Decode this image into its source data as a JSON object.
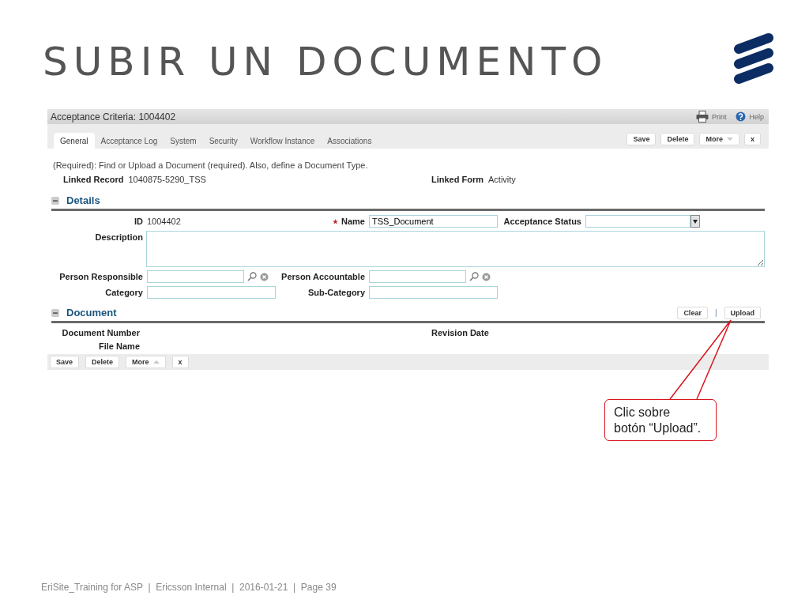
{
  "slide_title": "SUBIR UN DOCUMENTO",
  "app": {
    "title": "Acceptance Criteria: 1004402",
    "header_links": [
      {
        "kind": "print",
        "label": "Print"
      },
      {
        "kind": "help",
        "label": "Help"
      }
    ],
    "tabs": [
      {
        "label": "General",
        "selected": true
      },
      {
        "label": "Acceptance Log",
        "selected": false
      },
      {
        "label": "System",
        "selected": false
      },
      {
        "label": "Security",
        "selected": false
      },
      {
        "label": "Workflow Instance",
        "selected": false
      },
      {
        "label": "Associations",
        "selected": false
      }
    ],
    "top_buttons": [
      {
        "kind": "plain",
        "label": "Save"
      },
      {
        "kind": "plain",
        "label": "Delete"
      },
      {
        "kind": "menu_down",
        "label": "More"
      },
      {
        "kind": "plain",
        "label": "x"
      }
    ],
    "instructions": "(Required): Find or Upload a Document (required). Also, define a Document Type.",
    "linked": [
      {
        "label": "Linked Record",
        "value": "1040875-5290_TSS"
      },
      {
        "label": "Linked Form",
        "value": "Activity"
      }
    ],
    "details": {
      "title": "Details",
      "expanded": true,
      "rows": [
        [
          {
            "kind": "readout",
            "label": "ID",
            "value": "1004402",
            "required": false
          },
          {
            "kind": "input",
            "label": "Name",
            "value": "TSS_Document",
            "required": true
          },
          {
            "kind": "select",
            "label": "Acceptance Status",
            "required": false
          }
        ],
        [
          {
            "kind": "textarea",
            "label": "Description",
            "required": false
          }
        ],
        [
          {
            "kind": "lookup",
            "label": "Person Responsible",
            "required": false
          },
          {
            "kind": "lookup",
            "label": "Person Accountable",
            "required": false
          }
        ],
        [
          {
            "kind": "input",
            "label": "Category",
            "required": false
          },
          {
            "kind": "input",
            "label": "Sub-Category",
            "required": false
          }
        ]
      ]
    },
    "document": {
      "title": "Document",
      "expanded": true,
      "actions": [
        "Clear",
        "Upload"
      ],
      "separator": "|",
      "rows": [
        [
          "Document Number",
          "Revision Date"
        ],
        [
          "File Name"
        ]
      ]
    },
    "bottom_buttons": [
      {
        "kind": "plain",
        "label": "Save"
      },
      {
        "kind": "plain",
        "label": "Delete"
      },
      {
        "kind": "menu_up",
        "label": "More"
      },
      {
        "kind": "plain",
        "label": "x"
      }
    ]
  },
  "callout": {
    "text": "Clic sobre\nbotón “Upload”."
  },
  "footer": "EriSite_Training for ASP  |  Ericsson Internal  |  2016-01-21  |  Page 39"
}
